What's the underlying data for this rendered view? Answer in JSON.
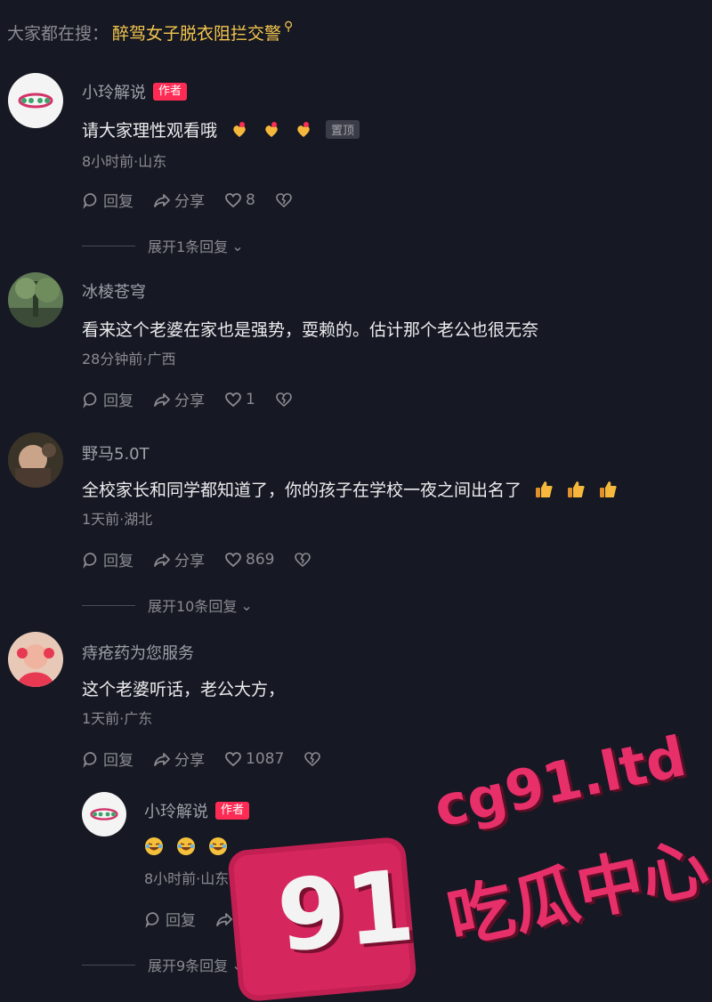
{
  "search": {
    "prefix": "大家都在搜：",
    "term": "醉驾女子脱衣阻拦交警",
    "icon": "search-icon"
  },
  "comments": [
    {
      "name": "小玲解说",
      "author_badge": "作者",
      "text": "请大家理性观看哦",
      "pin_badge": "置顶",
      "meta": "8小时前·山东",
      "reply": "回复",
      "share": "分享",
      "likes": "8",
      "expand": "展开1条回复"
    },
    {
      "name": "冰棱苍穹",
      "text": "看来这个老婆在家也是强势，耍赖的。估计那个老公也很无奈",
      "meta": "28分钟前·广西",
      "reply": "回复",
      "share": "分享",
      "likes": "1"
    },
    {
      "name": "野马5.0T",
      "text": "全校家长和同学都知道了，你的孩子在学校一夜之间出名了",
      "meta": "1天前·湖北",
      "reply": "回复",
      "share": "分享",
      "likes": "869",
      "expand": "展开10条回复"
    },
    {
      "name": "痔疮药为您服务",
      "text": "这个老婆听话，老公大方，",
      "meta": "1天前·广东",
      "reply": "回复",
      "share": "分享",
      "likes": "1087"
    },
    {
      "name": "小玲解说",
      "author_badge": "作者",
      "text": "",
      "meta": "8小时前·山东",
      "reply": "回复",
      "share": "分享",
      "likes": "",
      "expand": "展开9条回复"
    }
  ],
  "colors": {
    "accent": "#fe2c55",
    "search_term": "#f4c64e",
    "background": "#161823"
  },
  "watermark": {
    "number": "91",
    "site": "cg91.ltd",
    "label": "吃瓜中心"
  }
}
